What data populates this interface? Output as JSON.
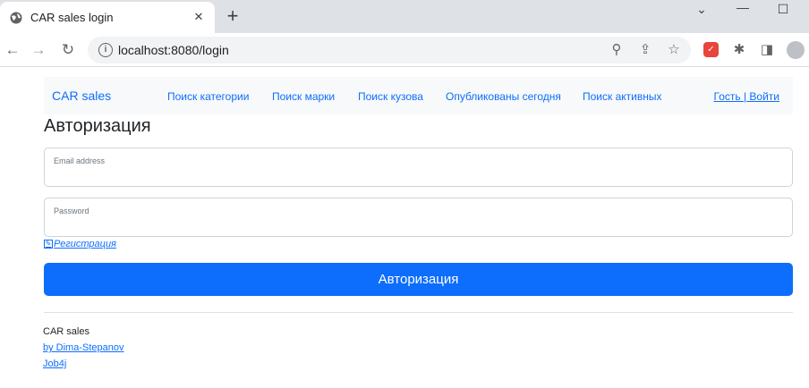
{
  "browser": {
    "tab_title": "CAR sales login",
    "tab_close": "✕",
    "new_tab": "+",
    "url": "localhost:8080/login",
    "window_controls": {
      "minimize": "—",
      "maximize": "☐",
      "chevron": "⌄"
    }
  },
  "navbar": {
    "brand": "CAR sales",
    "links": [
      "Поиск категории",
      "Поиск марки",
      "Поиск кузова",
      "Опубликованы сегодня",
      "Поиск активных"
    ],
    "login": "Гость | Войти"
  },
  "form": {
    "heading": "Авторизация",
    "email_label": "Email address",
    "email_value": "",
    "password_label": "Password",
    "password_value": "",
    "register_link": "Регистрация",
    "submit_label": "Авторизация"
  },
  "footer": {
    "title": "CAR sales",
    "author": "by Dima-Stepanov",
    "org": "Job4j"
  },
  "colors": {
    "primary": "#0d6efd",
    "navbar_bg": "#f8f9fa",
    "chrome_bg": "#dee1e6"
  },
  "icons": [
    "globe-icon",
    "back-icon",
    "forward-icon",
    "reload-icon",
    "info-icon",
    "zoom-icon",
    "share-icon",
    "star-icon",
    "extension-icon",
    "puzzle-icon",
    "sidepanel-icon",
    "profile-icon",
    "edit-icon"
  ]
}
